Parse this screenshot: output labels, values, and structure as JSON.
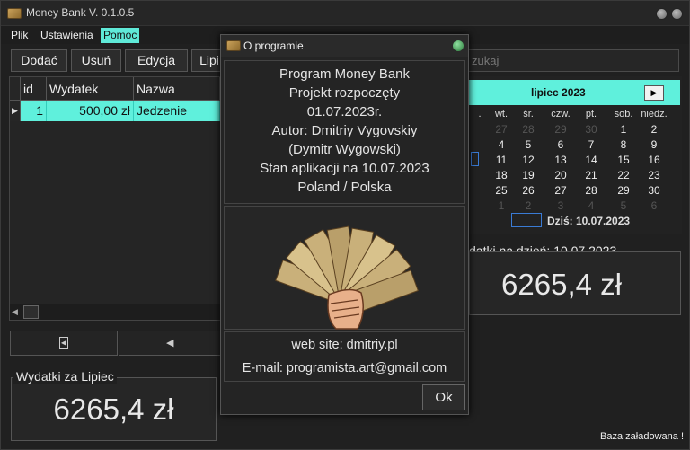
{
  "window": {
    "title": "Money Bank V. 0.1.0.5"
  },
  "menu": [
    {
      "label": "Plik"
    },
    {
      "label": "Ustawienia"
    },
    {
      "label": "Pomoc"
    }
  ],
  "toolbar": {
    "add": "Dodać",
    "remove": "Usuń",
    "edit": "Edycja",
    "month": "Lipi"
  },
  "search": {
    "placeholder": "zukaj"
  },
  "table": {
    "columns": [
      "id",
      "Wydatek",
      "Nazwa"
    ],
    "rows": [
      {
        "id": "1",
        "amount": "500,00 zł",
        "name": "Jedzenie"
      }
    ]
  },
  "summary_month": {
    "label": "Wydatki za Lipiec",
    "value": "6265,4 zł"
  },
  "summary_day": {
    "label": "datki na dzień:",
    "date": "10.07.2023",
    "value": "6265,4 zł"
  },
  "calendar": {
    "title": "lipiec 2023",
    "day_names": [
      ".",
      "wt.",
      "śr.",
      "czw.",
      "pt.",
      "sob.",
      "niedz."
    ],
    "weeks": [
      [
        "",
        "27",
        "28",
        "29",
        "30",
        "1",
        "2"
      ],
      [
        "",
        "4",
        "5",
        "6",
        "7",
        "8",
        "9"
      ],
      [
        "",
        "11",
        "12",
        "13",
        "14",
        "15",
        "16"
      ],
      [
        "",
        "18",
        "19",
        "20",
        "21",
        "22",
        "23"
      ],
      [
        "",
        "25",
        "26",
        "27",
        "28",
        "29",
        "30"
      ],
      [
        "",
        "1",
        "2",
        "3",
        "4",
        "5",
        "6"
      ]
    ],
    "today": "Dziś: 10.07.2023"
  },
  "dialog": {
    "title": "O programie",
    "info": [
      "Program Money Bank",
      "Projekt rozpoczęty",
      "01.07.2023r.",
      "Autor: Dmitriy Vygovskiy",
      "(Dymitr Wygowski)",
      "Stan aplikacji na 10.07.2023",
      "Poland / Polska"
    ],
    "website": "web site: dmitriy.pl",
    "email": "E-mail: programista.art@gmail.com",
    "ok": "Ok",
    "image_icon": "money-fan-icon"
  },
  "status": "Baza załadowana !",
  "colors": {
    "accent": "#5ff0dc",
    "background": "#202020"
  }
}
